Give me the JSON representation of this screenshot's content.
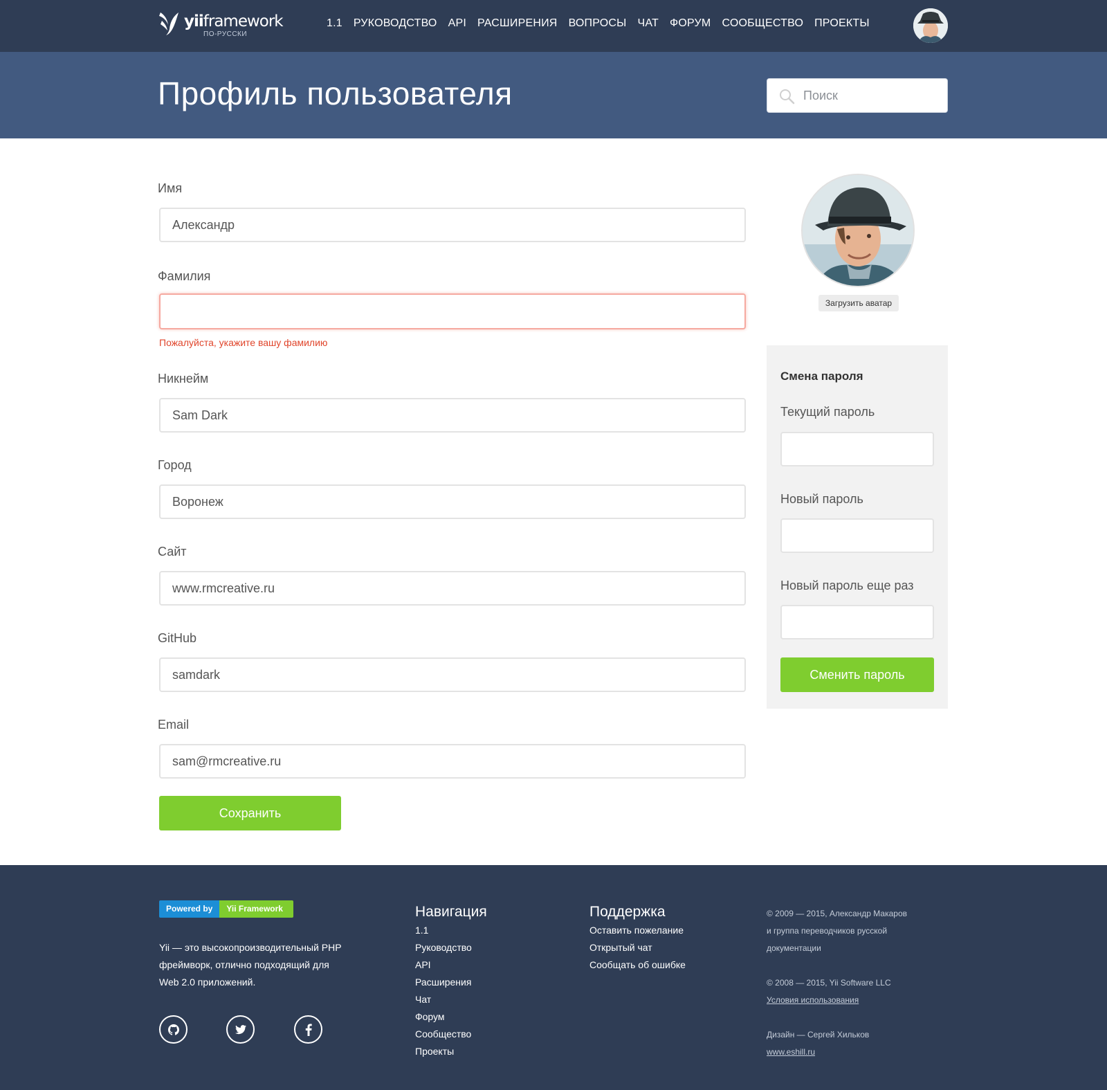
{
  "brand": {
    "name_bold": "yii",
    "name_rest": "framework",
    "subtitle": "ПО-РУССКИ"
  },
  "nav": {
    "items": [
      "1.1",
      "Руководство",
      "API",
      "Расширения",
      "Вопросы",
      "Чат",
      "Форум",
      "Сообщество",
      "Проекты"
    ]
  },
  "header": {
    "title": "Профиль пользователя"
  },
  "search": {
    "placeholder": "Поиск",
    "value": ""
  },
  "profile_form": {
    "fields": [
      {
        "label": "Имя",
        "value": "Александр"
      },
      {
        "label": "Фамилия",
        "value": "",
        "error": "Пожалуйста, укажите вашу фамилию"
      },
      {
        "label": "Никнейм",
        "value": "Sam Dark"
      },
      {
        "label": "Город",
        "value": "Воронеж"
      },
      {
        "label": "Сайт",
        "value": "www.rmcreative.ru"
      },
      {
        "label": "GitHub",
        "value": "samdark"
      },
      {
        "label": "Email",
        "value": "sam@rmcreative.ru"
      }
    ],
    "save_label": "Сохранить"
  },
  "avatar": {
    "upload_label": "Загрузить аватар"
  },
  "password": {
    "title": "Смена пароля",
    "current_label": "Текущий пароль",
    "new_label": "Новый пароль",
    "repeat_label": "Новый пароль еще раз",
    "submit_label": "Сменить пароль"
  },
  "footer": {
    "powered_by": "Powered by",
    "powered_name": "Yii Framework",
    "about": "Yii — это высокопроизводительный PHP фреймворк, отлично подходящий для Web 2.0 приложений.",
    "social_icons": [
      "github-icon",
      "twitter-icon",
      "facebook-icon"
    ],
    "nav_title": "Навигация",
    "nav_links": [
      "1.1",
      "Руководство",
      "API",
      "Расширения",
      "Чат",
      "Форум",
      "Сообщество",
      "Проекты"
    ],
    "support_title": "Поддержка",
    "support_links": [
      "Оставить пожелание",
      "Открытый чат",
      "Сообщать об ошибке"
    ],
    "copyright_1": "© 2009 — 2015, Александр Макаров",
    "copyright_2": "и группа переводчиков русской",
    "copyright_3": "документации",
    "copyright_4": "© 2008 — 2015, Yii Software LLC",
    "terms": "Условия использования",
    "design": "Дизайн — Сергей Хильков",
    "design_link": "www.eshill.ru"
  },
  "colors": {
    "nav_bg": "#2f3d55",
    "header_bg": "#425a80",
    "accent_green": "#7fcd2f",
    "error_red": "#e0452b",
    "badge_blue": "#1c8ed6"
  }
}
